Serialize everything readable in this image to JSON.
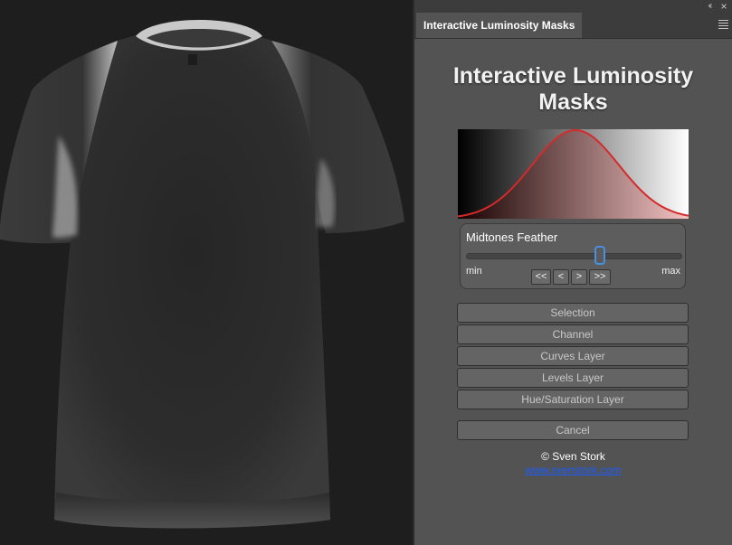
{
  "panel": {
    "tab_title": "Interactive Luminosity Masks",
    "title_line1": "Interactive Luminosity",
    "title_line2": "Masks",
    "collapse_icon": "double-chevron-left-icon",
    "close_icon": "close-icon",
    "menu_icon": "hamburger-menu-icon"
  },
  "curve": {
    "stroke_color": "#d42a2a",
    "fill_color_left": "#1a0000",
    "fill_color_right": "#f3b9b9"
  },
  "slider": {
    "label": "Midtones Feather",
    "min_label": "min",
    "max_label": "max",
    "value": 0.62,
    "thumb_color": "#4b8fe0",
    "step_buttons": [
      "<<",
      "<",
      ">",
      ">>"
    ]
  },
  "actions": [
    "Selection",
    "Channel",
    "Curves Layer",
    "Levels Layer",
    "Hue/Saturation Layer"
  ],
  "cancel_label": "Cancel",
  "credit": {
    "author": "© Sven Stork",
    "link": "www.svenstork.com"
  }
}
